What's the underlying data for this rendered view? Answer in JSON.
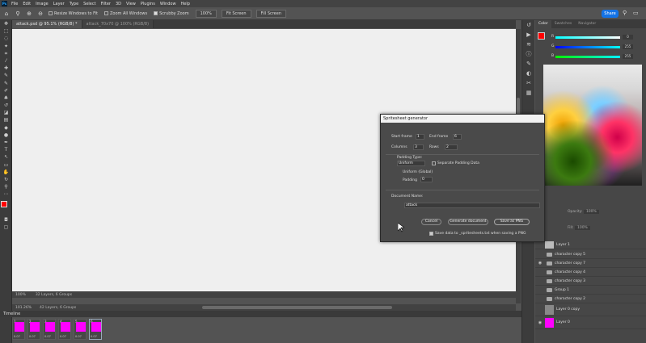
{
  "menubar": {
    "logo": "Ps",
    "items": [
      "File",
      "Edit",
      "Image",
      "Layer",
      "Type",
      "Select",
      "Filter",
      "3D",
      "View",
      "Plugins",
      "Window",
      "Help"
    ]
  },
  "options": {
    "resize_windows": "Resize Windows to Fit",
    "zoom_all": "Zoom All Windows",
    "scrubby_zoom": "Scrubby Zoom",
    "zoom_pct": "100%",
    "fit_screen": "Fit Screen",
    "fill_screen": "Fill Screen"
  },
  "share_label": "Share",
  "tabs": [
    {
      "label": "attack.psd @ 95.1% (RGB/8) *"
    },
    {
      "label": "attack_70x70 @ 100% (RGB/8)"
    }
  ],
  "statusbar": {
    "zoom": "100%",
    "info": "32 Layers, 6 Groups"
  },
  "hbar": {
    "zoom": "101.26%",
    "info": "42 Layers, 6 Groups"
  },
  "timeline": {
    "title": "Timeline",
    "frames": [
      {
        "num": "1",
        "dur": "0.07"
      },
      {
        "num": "2",
        "dur": "0.07"
      },
      {
        "num": "3",
        "dur": "0.07"
      },
      {
        "num": "4",
        "dur": "0.07"
      },
      {
        "num": "5",
        "dur": "0.07"
      },
      {
        "num": "6",
        "dur": "0.07"
      }
    ]
  },
  "color_panel": {
    "tabs": [
      "Color",
      "Swatches",
      "Navigator"
    ],
    "r_label": "R",
    "g_label": "G",
    "b_label": "B",
    "r": "0",
    "g": "255",
    "b": "255"
  },
  "layers": {
    "opacity_label": "Opacity:",
    "opacity": "100%",
    "fill_label": "Fill:",
    "fill": "100%",
    "items": [
      {
        "name": "Layer 1",
        "type": "layer",
        "eye": false
      },
      {
        "name": "character copy 5",
        "type": "group",
        "eye": false
      },
      {
        "name": "character copy 7",
        "type": "group",
        "eye": true
      },
      {
        "name": "character copy 4",
        "type": "group",
        "eye": false
      },
      {
        "name": "character copy 3",
        "type": "group",
        "eye": false
      },
      {
        "name": "Group 1",
        "type": "group",
        "eye": false
      },
      {
        "name": "character copy 2",
        "type": "group",
        "eye": false
      },
      {
        "name": "Layer 0 copy",
        "type": "layer",
        "eye": false
      },
      {
        "name": "Layer 0",
        "type": "layer-mag",
        "eye": true
      }
    ]
  },
  "dialog": {
    "title": "Spritesheet generator",
    "start_frame_label": "Start frame",
    "start_frame": "1",
    "end_frame_label": "End frame",
    "end_frame": "6",
    "columns_label": "Columns",
    "columns": "3",
    "rows_label": "Rows",
    "rows": "2",
    "padding_type_label": "Padding Type:",
    "padding_type": "Uniform",
    "separate_padding_label": "Separate Padding Data",
    "uniform_label": "Uniform (Global)",
    "padding_label": "Padding",
    "padding": "0",
    "doc_name_label": "Document Name:",
    "doc_name": "attack",
    "cancel": "Cancel",
    "generate": "Generate document",
    "save_png": "Save as PNG",
    "save_data_label": "Save data to _spritesheets.txt when saving a PNG"
  }
}
